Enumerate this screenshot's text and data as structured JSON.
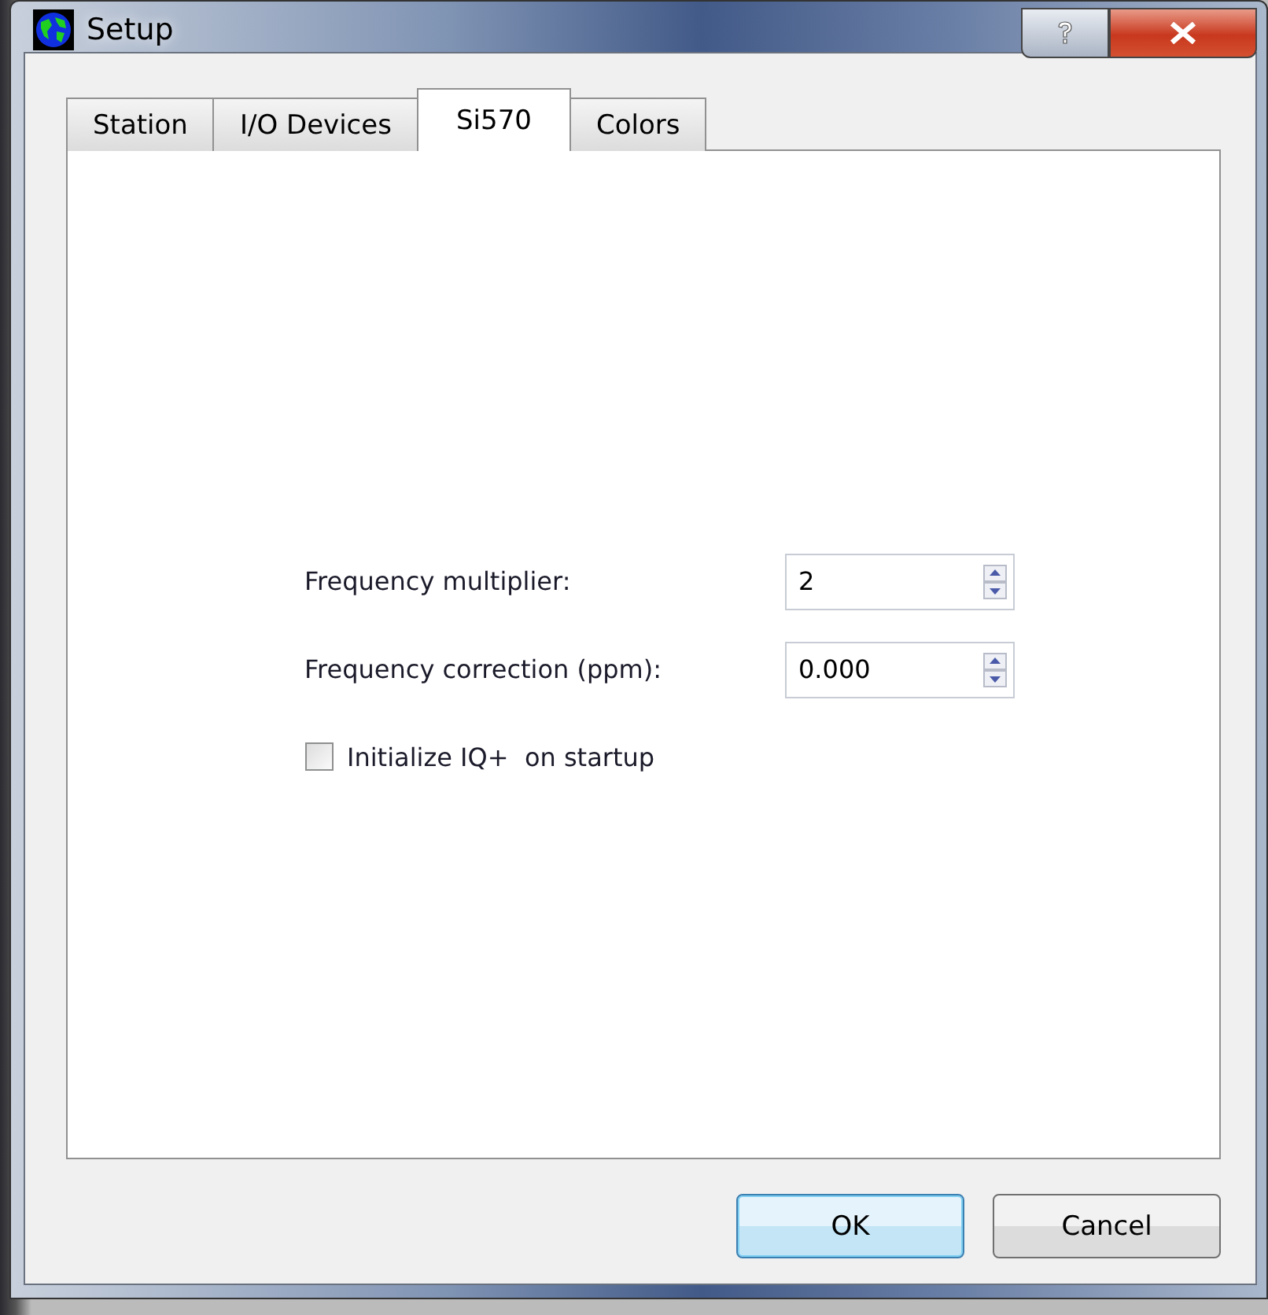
{
  "window": {
    "title": "Setup"
  },
  "tabs": [
    {
      "label": "Station",
      "selected": false
    },
    {
      "label": "I/O Devices",
      "selected": false
    },
    {
      "label": "Si570",
      "selected": true
    },
    {
      "label": "Colors",
      "selected": false
    }
  ],
  "fields": [
    {
      "label": "Frequency multiplier:",
      "value": "2"
    },
    {
      "label": "Frequency correction (ppm):",
      "value": "0.000"
    }
  ],
  "checkbox": {
    "label": "Initialize IQ+  on startup",
    "checked": false
  },
  "buttons": [
    {
      "label": "OK",
      "default": true
    },
    {
      "label": "Cancel",
      "default": false
    }
  ]
}
